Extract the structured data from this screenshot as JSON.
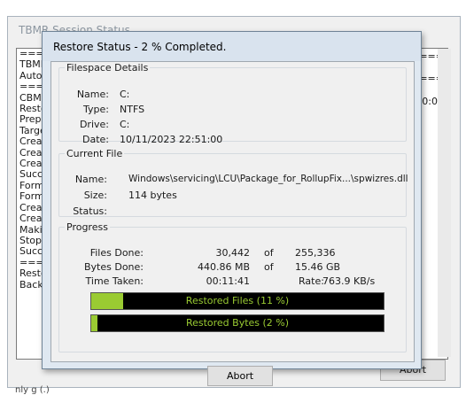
{
  "background_window": {
    "title": "TBMR Session Status",
    "log_lines": [
      "=====",
      "TBMF",
      "Autom",
      "=====",
      "CBMF",
      "Resto",
      "Prepa",
      "Targe",
      "Creati",
      "Creati",
      "Create",
      "Succe",
      "Forma",
      "Forma",
      "Creati",
      "Creati",
      "Makin",
      "Stopp",
      "Succe",
      "=====",
      "Resto",
      "Backu"
    ],
    "right_fragments": [
      "===",
      "===",
      "0:00"
    ],
    "abort_label": "Abort",
    "footer_fragment": "nly g (.)"
  },
  "dialog": {
    "title": "Restore Status - 2 % Completed.",
    "filespace": {
      "legend": "Filespace Details",
      "name_label": "Name:",
      "name_value": "C:",
      "type_label": "Type:",
      "type_value": "NTFS",
      "drive_label": "Drive:",
      "drive_value": "C:",
      "date_label": "Date:",
      "date_value": "10/11/2023 22:51:00"
    },
    "current_file": {
      "legend": "Current File",
      "name_label": "Name:",
      "name_value": "Windows\\servicing\\LCU\\Package_for_RollupFix...\\spwizres.dll",
      "size_label": "Size:",
      "size_value": "114 bytes",
      "status_label": "Status:",
      "status_value": ""
    },
    "progress": {
      "legend": "Progress",
      "files_done_label": "Files Done:",
      "files_done_value": "30,442",
      "files_of": "of",
      "files_total": "255,336",
      "bytes_done_label": "Bytes Done:",
      "bytes_done_value": "440.86 MB",
      "bytes_of": "of",
      "bytes_total": "15.46 GB",
      "time_taken_label": "Time Taken:",
      "time_taken_value": "00:11:41",
      "rate_label": "Rate:",
      "rate_value": "763.9 KB/s",
      "files_bar_text": "Restored Files (11 %)",
      "files_bar_percent": 11,
      "bytes_bar_text": "Restored Bytes (2 %)",
      "bytes_bar_percent": 2
    },
    "abort_label": "Abort"
  },
  "colors": {
    "bar_fill": "#9acb32",
    "bar_background": "#000000"
  }
}
